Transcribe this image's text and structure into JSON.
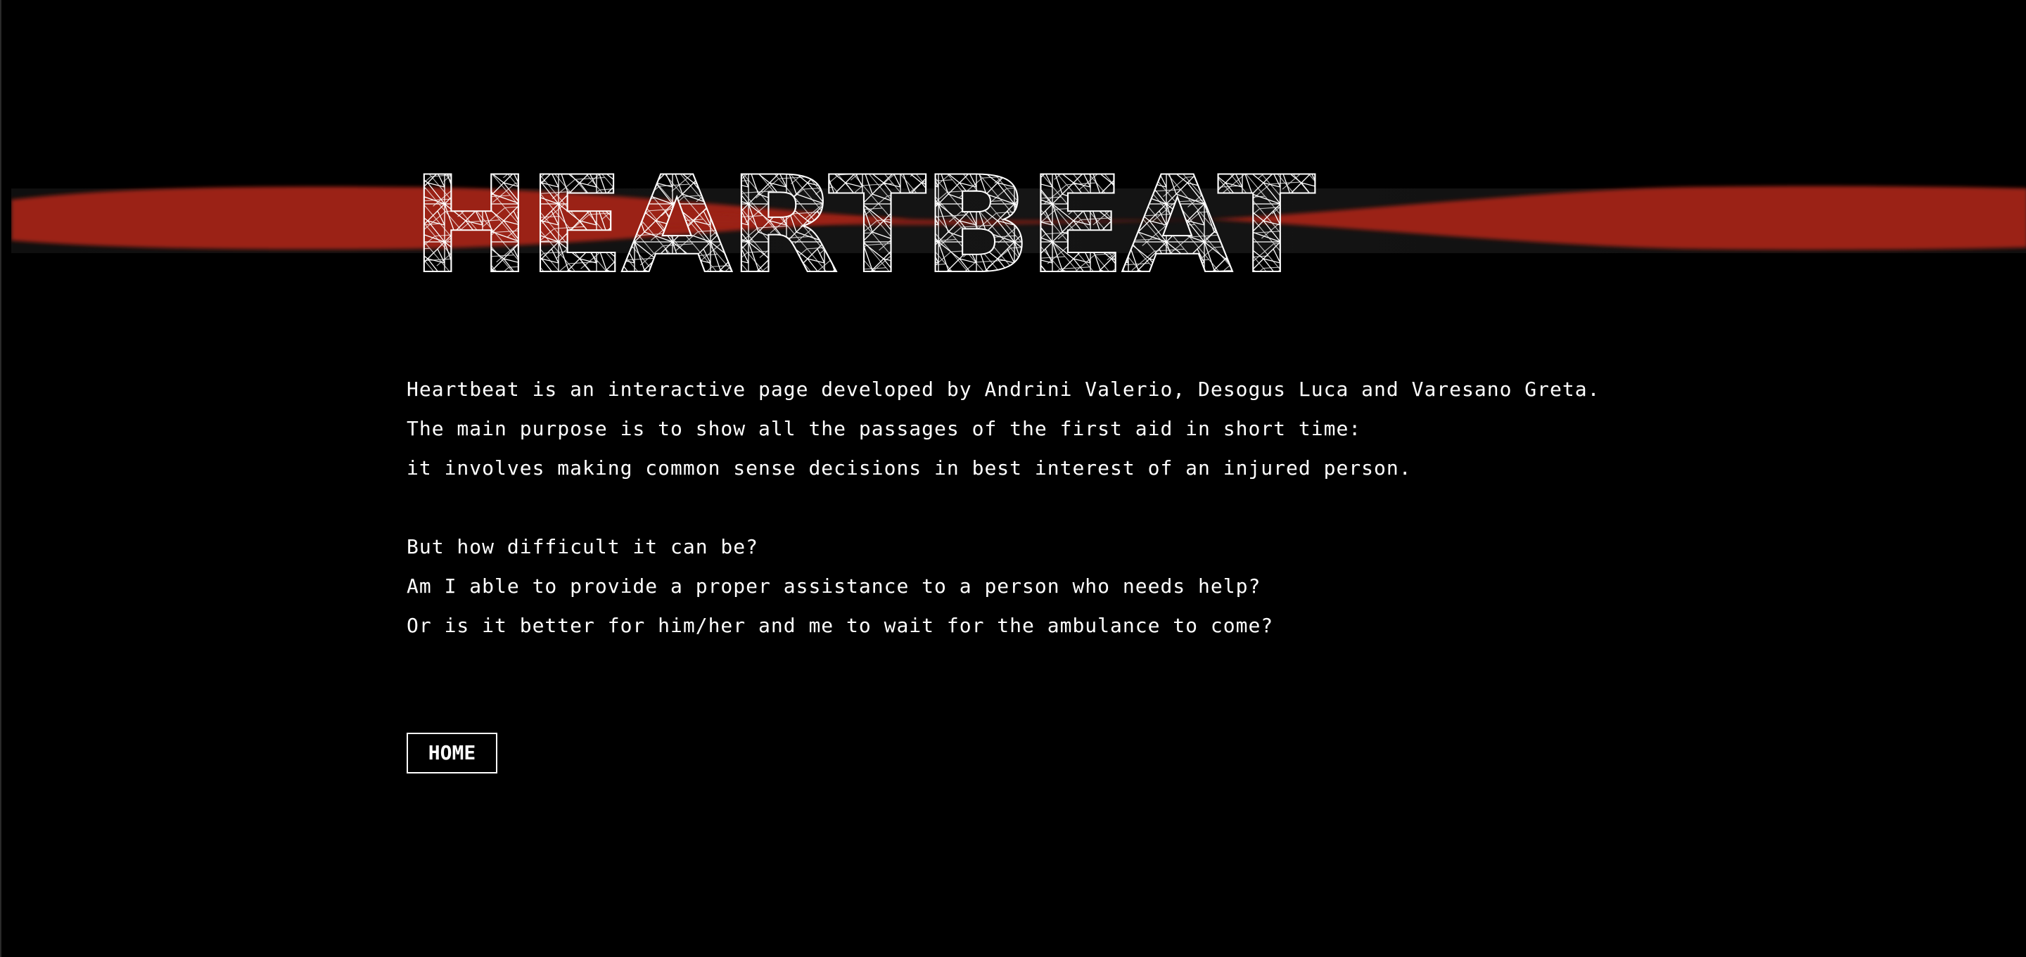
{
  "colors": {
    "background": "#000000",
    "accent": "#9b2119",
    "text": "#ffffff"
  },
  "header": {
    "title": "HEARTBEAT"
  },
  "intro": {
    "paragraphs": [
      [
        "Heartbeat is an interactive page developed by Andrini Valerio, Desogus Luca and Varesano Greta.",
        "The main purpose is to show all the passages of the first aid in short time:",
        "it involves making common sense decisions in best interest of an injured person."
      ],
      [
        "But how difficult it can be?",
        "Am I able to provide a proper assistance to a person who needs help?",
        "Or is it better for him/her and me to wait for the ambulance to come?"
      ]
    ]
  },
  "nav": {
    "home_label": "HOME"
  }
}
